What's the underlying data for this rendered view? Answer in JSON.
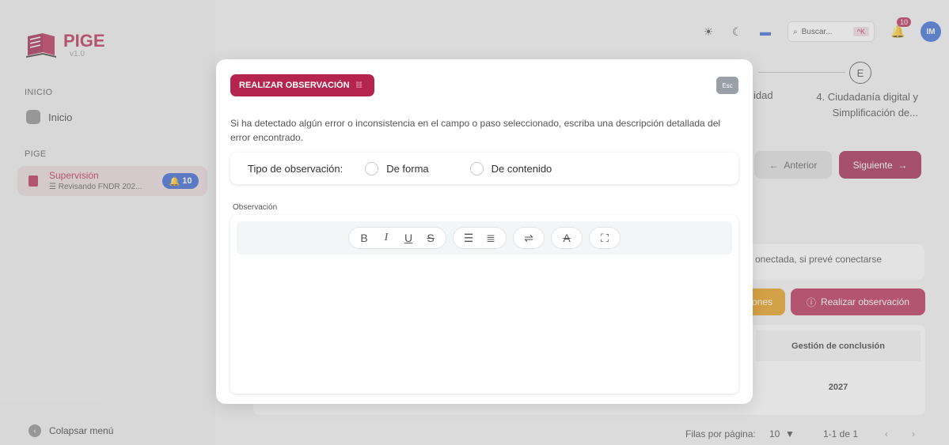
{
  "app": {
    "name": "PIGE",
    "version": "v1.0"
  },
  "sidebar": {
    "section_home": "INICIO",
    "home_item": "Inicio",
    "section_pige": "PIGE",
    "supervision": {
      "title": "Supervisión",
      "subtitle": "Revisando FNDR 202...",
      "badge": "10"
    },
    "collapse": "Colapsar menú"
  },
  "topbar": {
    "search_placeholder": "Buscar...",
    "shortcut": "^K",
    "notifications": "10",
    "avatar": "IM"
  },
  "stepper": {
    "step_letter": "E",
    "left_label": "idad",
    "right_label": "4. Ciudadanía digital y Simplificación de..."
  },
  "nav": {
    "prev": "Anterior",
    "next": "Siguiente"
  },
  "content": {
    "info_text": "onectada, si prevé conectarse",
    "orange_button": "ones",
    "observe_button": "Realizar observación",
    "table_header": "Gestión de conclusión",
    "table_cell": "2027"
  },
  "pagination": {
    "rows_label": "Filas por página:",
    "rows_value": "10",
    "range": "1-1 de 1"
  },
  "modal": {
    "title": "REALIZAR OBSERVACIÓN",
    "esc": "Esc",
    "description": "Si ha detectado algún error o inconsistencia en el campo o paso seleccionado, escriba una descripción detallada del error encontrado.",
    "type_label": "Tipo de observación:",
    "option_form": "De forma",
    "option_content": "De contenido",
    "observation_label": "Observación"
  },
  "colors": {
    "brand": "#b5244f",
    "accent_blue": "#2f5fd0",
    "warning": "#e79a10"
  }
}
